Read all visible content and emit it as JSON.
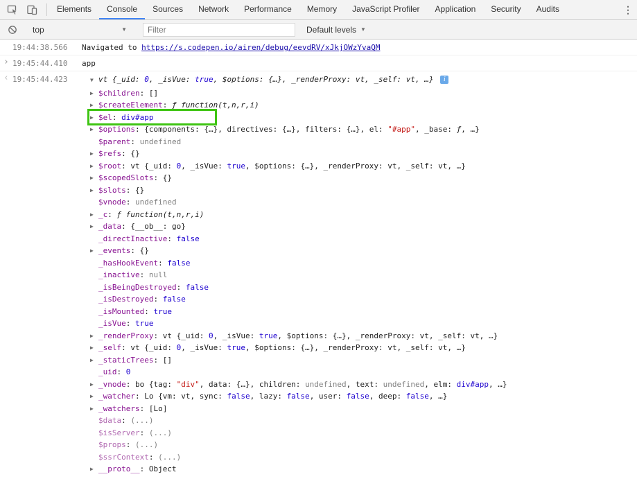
{
  "colors": {
    "tab_accent": "#4285f4",
    "annotation_green": "#3ec412",
    "property_purple": "#881391",
    "value_blue": "#1c00cf",
    "string_red": "#c41a16",
    "muted_gray": "#808080",
    "link_blue": "#1a0dab"
  },
  "icons": {
    "inspect": "inspect-cursor-icon",
    "device": "device-toolbar-icon",
    "more": "⋮",
    "clear": "clear-console-icon",
    "dropdown": "▼",
    "input_chevron": "›",
    "result_chevron": "‹",
    "expand_open": "▼",
    "expand_closed": "▶",
    "info": "i"
  },
  "tabbar": {
    "tabs": [
      "Elements",
      "Console",
      "Sources",
      "Network",
      "Performance",
      "Memory",
      "JavaScript Profiler",
      "Application",
      "Security",
      "Audits"
    ],
    "active": "Console"
  },
  "toolbar": {
    "context": "top",
    "filter_placeholder": "Filter",
    "levels": "Default levels"
  },
  "console": {
    "messages": [
      {
        "type": "nav",
        "timestamp": "19:44:38.566",
        "text": "Navigated to ",
        "link": "https://s.codepen.io/airen/debug/eevdRV/xJkjOWzYvaQM"
      },
      {
        "type": "input",
        "timestamp": "19:45:44.410",
        "text": "app"
      },
      {
        "type": "result",
        "timestamp": "19:45:44.423",
        "preview": [
          [
            "o",
            "vt {_uid: "
          ],
          [
            "n",
            "0"
          ],
          [
            "o",
            ", _isVue: "
          ],
          [
            "n",
            "true"
          ],
          [
            "o",
            ", $options: {…}, _renderProxy: vt, _self: vt, …}"
          ]
        ],
        "tree": [
          {
            "exp": true,
            "key": "$children",
            "val": [
              [
                "o",
                "[]"
              ]
            ]
          },
          {
            "exp": true,
            "key": "$createElement",
            "val": [
              [
                "f",
                "ƒ function(t,n,r,i)"
              ]
            ]
          },
          {
            "exp": true,
            "key": "$el",
            "val": [
              [
                "nd",
                "div#app"
              ]
            ],
            "highlight": true
          },
          {
            "exp": true,
            "key": "$options",
            "val": [
              [
                "o",
                "{components: {…}, directives: {…}, filters: {…}, el: "
              ],
              [
                "s",
                "\"#app\""
              ],
              [
                "o",
                ", _base: "
              ],
              [
                "f",
                "ƒ"
              ],
              [
                "o",
                ", …}"
              ]
            ]
          },
          {
            "exp": false,
            "key": "$parent",
            "val": [
              [
                "u",
                "undefined"
              ]
            ]
          },
          {
            "exp": true,
            "key": "$refs",
            "val": [
              [
                "o",
                "{}"
              ]
            ]
          },
          {
            "exp": true,
            "key": "$root",
            "val": [
              [
                "o",
                "vt {_uid: "
              ],
              [
                "n",
                "0"
              ],
              [
                "o",
                ", _isVue: "
              ],
              [
                "n",
                "true"
              ],
              [
                "o",
                ", $options: {…}, _renderProxy: vt, _self: vt, …}"
              ]
            ]
          },
          {
            "exp": true,
            "key": "$scopedSlots",
            "val": [
              [
                "o",
                "{}"
              ]
            ]
          },
          {
            "exp": true,
            "key": "$slots",
            "val": [
              [
                "o",
                "{}"
              ]
            ]
          },
          {
            "exp": false,
            "key": "$vnode",
            "val": [
              [
                "u",
                "undefined"
              ]
            ]
          },
          {
            "exp": true,
            "key": "_c",
            "val": [
              [
                "f",
                "ƒ function(t,n,r,i)"
              ]
            ]
          },
          {
            "exp": true,
            "key": "_data",
            "val": [
              [
                "o",
                "{__ob__: go}"
              ]
            ]
          },
          {
            "exp": false,
            "key": "_directInactive",
            "val": [
              [
                "n",
                "false"
              ]
            ]
          },
          {
            "exp": true,
            "key": "_events",
            "val": [
              [
                "o",
                "{}"
              ]
            ]
          },
          {
            "exp": false,
            "key": "_hasHookEvent",
            "val": [
              [
                "n",
                "false"
              ]
            ]
          },
          {
            "exp": false,
            "key": "_inactive",
            "val": [
              [
                "u",
                "null"
              ]
            ]
          },
          {
            "exp": false,
            "key": "_isBeingDestroyed",
            "val": [
              [
                "n",
                "false"
              ]
            ]
          },
          {
            "exp": false,
            "key": "_isDestroyed",
            "val": [
              [
                "n",
                "false"
              ]
            ]
          },
          {
            "exp": false,
            "key": "_isMounted",
            "val": [
              [
                "n",
                "true"
              ]
            ]
          },
          {
            "exp": false,
            "key": "_isVue",
            "val": [
              [
                "n",
                "true"
              ]
            ]
          },
          {
            "exp": true,
            "key": "_renderProxy",
            "val": [
              [
                "o",
                "vt {_uid: "
              ],
              [
                "n",
                "0"
              ],
              [
                "o",
                ", _isVue: "
              ],
              [
                "n",
                "true"
              ],
              [
                "o",
                ", $options: {…}, _renderProxy: vt, _self: vt, …}"
              ]
            ]
          },
          {
            "exp": true,
            "key": "_self",
            "val": [
              [
                "o",
                "vt {_uid: "
              ],
              [
                "n",
                "0"
              ],
              [
                "o",
                ", _isVue: "
              ],
              [
                "n",
                "true"
              ],
              [
                "o",
                ", $options: {…}, _renderProxy: vt, _self: vt, …}"
              ]
            ]
          },
          {
            "exp": true,
            "key": "_staticTrees",
            "val": [
              [
                "o",
                "[]"
              ]
            ]
          },
          {
            "exp": false,
            "key": "_uid",
            "val": [
              [
                "n",
                "0"
              ]
            ]
          },
          {
            "exp": true,
            "key": "_vnode",
            "val": [
              [
                "o",
                "bo {tag: "
              ],
              [
                "s",
                "\"div\""
              ],
              [
                "o",
                ", data: {…}, children: "
              ],
              [
                "u",
                "undefined"
              ],
              [
                "o",
                ", text: "
              ],
              [
                "u",
                "undefined"
              ],
              [
                "o",
                ", elm: "
              ],
              [
                "nd",
                "div#app"
              ],
              [
                "o",
                ", …}"
              ]
            ]
          },
          {
            "exp": true,
            "key": "_watcher",
            "val": [
              [
                "o",
                "Lo {vm: vt, sync: "
              ],
              [
                "n",
                "false"
              ],
              [
                "o",
                ", lazy: "
              ],
              [
                "n",
                "false"
              ],
              [
                "o",
                ", user: "
              ],
              [
                "n",
                "false"
              ],
              [
                "o",
                ", deep: "
              ],
              [
                "n",
                "false"
              ],
              [
                "o",
                ", …}"
              ]
            ]
          },
          {
            "exp": true,
            "key": "_watchers",
            "val": [
              [
                "o",
                "[Lo]"
              ]
            ]
          },
          {
            "exp": false,
            "dim": true,
            "key": "$data",
            "val": [
              [
                "u",
                "(...)"
              ]
            ]
          },
          {
            "exp": false,
            "dim": true,
            "key": "$isServer",
            "val": [
              [
                "u",
                "(...)"
              ]
            ]
          },
          {
            "exp": false,
            "dim": true,
            "key": "$props",
            "val": [
              [
                "u",
                "(...)"
              ]
            ]
          },
          {
            "exp": false,
            "dim": true,
            "key": "$ssrContext",
            "val": [
              [
                "u",
                "(...)"
              ]
            ]
          },
          {
            "exp": true,
            "key": "__proto__",
            "val": [
              [
                "o",
                "Object"
              ]
            ]
          }
        ]
      }
    ]
  }
}
